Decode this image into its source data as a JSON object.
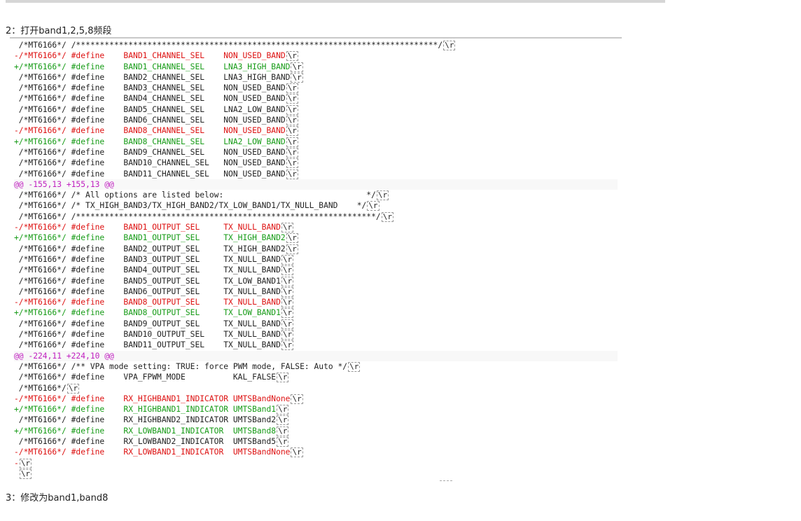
{
  "steps": {
    "step1": "2：打开band1,2,5,8频段",
    "step2": "3：修改为band1,band8"
  },
  "cr_marker": "\\r",
  "lines": [
    {
      "type": "ctx",
      "text": " /*MT6166*/ /****************************************************************************/",
      "cr": true
    },
    {
      "type": "del",
      "text": "-/*MT6166*/ #define    BAND1_CHANNEL_SEL    NON_USED_BAND",
      "cr": true
    },
    {
      "type": "add",
      "text": "+/*MT6166*/ #define    BAND1_CHANNEL_SEL    LNA3_HIGH_BAND",
      "cr": true
    },
    {
      "type": "ctx",
      "text": " /*MT6166*/ #define    BAND2_CHANNEL_SEL    LNA3_HIGH_BAND",
      "cr": true
    },
    {
      "type": "ctx",
      "text": " /*MT6166*/ #define    BAND3_CHANNEL_SEL    NON_USED_BAND",
      "cr": true
    },
    {
      "type": "ctx",
      "text": " /*MT6166*/ #define    BAND4_CHANNEL_SEL    NON_USED_BAND",
      "cr": true
    },
    {
      "type": "ctx",
      "text": " /*MT6166*/ #define    BAND5_CHANNEL_SEL    LNA2_LOW_BAND",
      "cr": true
    },
    {
      "type": "ctx",
      "text": " /*MT6166*/ #define    BAND6_CHANNEL_SEL    NON_USED_BAND",
      "cr": true
    },
    {
      "type": "del",
      "text": "-/*MT6166*/ #define    BAND8_CHANNEL_SEL    NON_USED_BAND",
      "cr": true
    },
    {
      "type": "add",
      "text": "+/*MT6166*/ #define    BAND8_CHANNEL_SEL    LNA2_LOW_BAND",
      "cr": true
    },
    {
      "type": "ctx",
      "text": " /*MT6166*/ #define    BAND9_CHANNEL_SEL    NON_USED_BAND",
      "cr": true
    },
    {
      "type": "ctx",
      "text": " /*MT6166*/ #define    BAND10_CHANNEL_SEL   NON_USED_BAND",
      "cr": true
    },
    {
      "type": "ctx",
      "text": " /*MT6166*/ #define    BAND11_CHANNEL_SEL   NON_USED_BAND",
      "cr": true
    },
    {
      "type": "hunk",
      "text": "@@ -155,13 +155,13 @@",
      "cr": false
    },
    {
      "type": "ctx",
      "text": " /*MT6166*/ /* All options are listed below:                              */",
      "cr": true
    },
    {
      "type": "ctx",
      "text": " /*MT6166*/ /* TX_HIGH_BAND3/TX_HIGH_BAND2/TX_LOW_BAND1/TX_NULL_BAND    */",
      "cr": true
    },
    {
      "type": "ctx",
      "text": " /*MT6166*/ /***************************************************************/",
      "cr": true
    },
    {
      "type": "del",
      "text": "-/*MT6166*/ #define    BAND1_OUTPUT_SEL     TX_NULL_BAND",
      "cr": true
    },
    {
      "type": "add",
      "text": "+/*MT6166*/ #define    BAND1_OUTPUT_SEL     TX_HIGH_BAND2",
      "cr": true
    },
    {
      "type": "ctx",
      "text": " /*MT6166*/ #define    BAND2_OUTPUT_SEL     TX_HIGH_BAND2",
      "cr": true
    },
    {
      "type": "ctx",
      "text": " /*MT6166*/ #define    BAND3_OUTPUT_SEL     TX_NULL_BAND",
      "cr": true
    },
    {
      "type": "ctx",
      "text": " /*MT6166*/ #define    BAND4_OUTPUT_SEL     TX_NULL_BAND",
      "cr": true
    },
    {
      "type": "ctx",
      "text": " /*MT6166*/ #define    BAND5_OUTPUT_SEL     TX_LOW_BAND1",
      "cr": true
    },
    {
      "type": "ctx",
      "text": " /*MT6166*/ #define    BAND6_OUTPUT_SEL     TX_NULL_BAND",
      "cr": true
    },
    {
      "type": "del",
      "text": "-/*MT6166*/ #define    BAND8_OUTPUT_SEL     TX_NULL_BAND",
      "cr": true
    },
    {
      "type": "add",
      "text": "+/*MT6166*/ #define    BAND8_OUTPUT_SEL     TX_LOW_BAND1",
      "cr": true
    },
    {
      "type": "ctx",
      "text": " /*MT6166*/ #define    BAND9_OUTPUT_SEL     TX_NULL_BAND",
      "cr": true
    },
    {
      "type": "ctx",
      "text": " /*MT6166*/ #define    BAND10_OUTPUT_SEL    TX_NULL_BAND",
      "cr": true
    },
    {
      "type": "ctx",
      "text": " /*MT6166*/ #define    BAND11_OUTPUT_SEL    TX_NULL_BAND",
      "cr": true
    },
    {
      "type": "hunk",
      "text": "@@ -224,11 +224,10 @@",
      "cr": false
    },
    {
      "type": "ctx",
      "text": " /*MT6166*/ /** VPA mode setting: TRUE: force PWM mode, FALSE: Auto */",
      "cr": true
    },
    {
      "type": "ctx",
      "text": " /*MT6166*/ #define    VPA_FPWM_MODE          KAL_FALSE",
      "cr": true
    },
    {
      "type": "ctx",
      "text": " /*MT6166*/",
      "cr": true
    },
    {
      "type": "del",
      "text": "-/*MT6166*/ #define    RX_HIGHBAND1_INDICATOR UMTSBandNone",
      "cr": true
    },
    {
      "type": "add",
      "text": "+/*MT6166*/ #define    RX_HIGHBAND1_INDICATOR UMTSBand1",
      "cr": true
    },
    {
      "type": "ctx",
      "text": " /*MT6166*/ #define    RX_HIGHBAND2_INDICATOR UMTSBand2",
      "cr": true
    },
    {
      "type": "add",
      "text": "+/*MT6166*/ #define    RX_LOWBAND1_INDICATOR  UMTSBand8",
      "cr": true
    },
    {
      "type": "ctx",
      "text": " /*MT6166*/ #define    RX_LOWBAND2_INDICATOR  UMTSBand5",
      "cr": true
    },
    {
      "type": "del",
      "text": "-/*MT6166*/ #define    RX_LOWBAND1_INDICATOR  UMTSBandNone",
      "cr": true
    },
    {
      "type": "del",
      "text": "-",
      "cr": true
    },
    {
      "type": "ctx",
      "text": " ",
      "cr": true
    }
  ]
}
